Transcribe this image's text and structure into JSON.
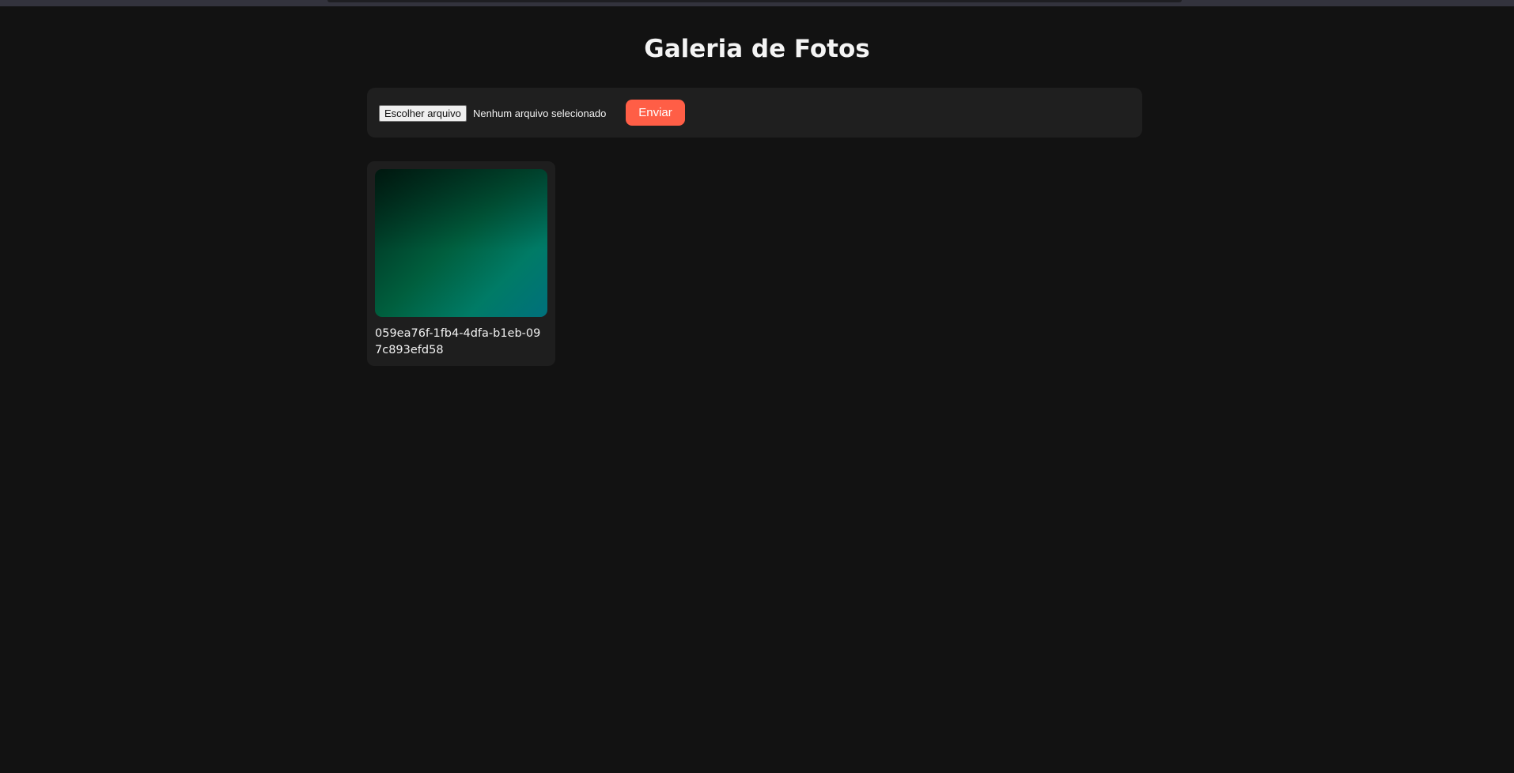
{
  "page": {
    "title": "Galeria de Fotos"
  },
  "upload": {
    "file_button_label": "Escolher arquivo",
    "file_status": "Nenhum arquivo selecionado",
    "submit_label": "Enviar"
  },
  "gallery": {
    "photos": [
      {
        "caption": "059ea76f-1fb4-4dfa-b1eb-097c893efd58"
      }
    ]
  },
  "colors": {
    "background": "#121212",
    "panel": "#1f1f1f",
    "accent": "#ff5e46"
  }
}
